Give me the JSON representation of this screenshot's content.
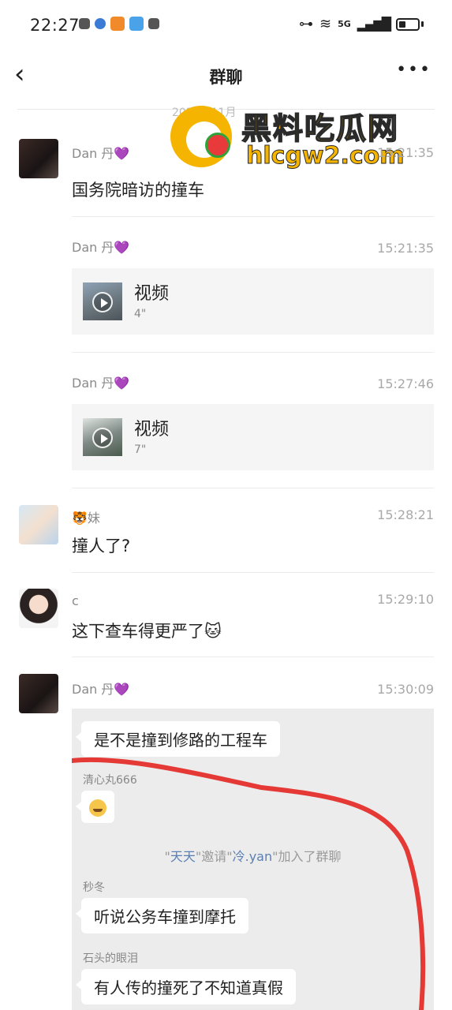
{
  "status": {
    "time": "22:27",
    "network": "5G"
  },
  "header": {
    "back": "‹",
    "title": "群聊",
    "more": "•••"
  },
  "watermark": {
    "title": "黑料吃瓜网",
    "url": "hlcgw2.com",
    "date": "2024年11月"
  },
  "messages": [
    {
      "name": "Dan 丹💜",
      "time": "15:21:35",
      "text": "国务院暗访的撞车"
    },
    {
      "name": "Dan 丹💜",
      "time": "15:21:35",
      "video_label": "视频",
      "video_duration": "4\""
    },
    {
      "name": "Dan 丹💜",
      "time": "15:27:46",
      "video_label": "视频",
      "video_duration": "7\""
    },
    {
      "name": "🐯妹",
      "time": "15:28:21",
      "text": "撞人了?"
    },
    {
      "name": "c",
      "time": "15:29:10",
      "text": "这下查车得更严了🐱"
    },
    {
      "name": "Dan 丹💜",
      "time": "15:30:09"
    }
  ],
  "screenshot": {
    "bubble1": "是不是撞到修路的工程车",
    "sender2": "清心丸666",
    "system_parts": [
      "\"",
      "天天",
      "\"邀请\"",
      "冷.yan",
      "\"加入了群聊"
    ],
    "sender3": "秒冬",
    "bubble3": "听说公务车撞到摩托",
    "sender4": "石头的眼泪",
    "bubble4": "有人传的撞死了不知道真假"
  }
}
